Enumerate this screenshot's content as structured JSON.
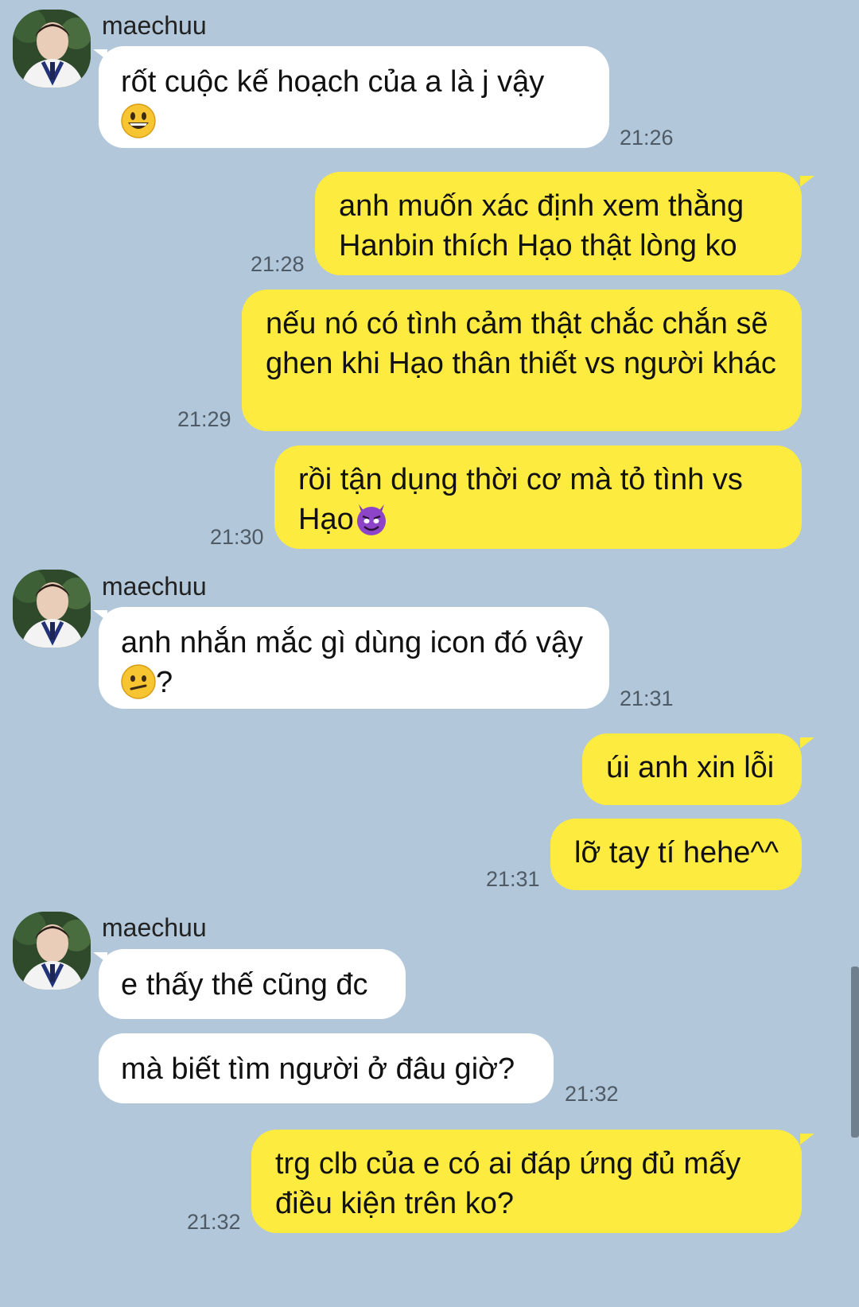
{
  "conversation": {
    "groups": [
      {
        "sender": "maechuu",
        "messages": [
          {
            "text": "rốt cuộc kế hoạch của a là j vậy",
            "emoji": "grinning-face-icon",
            "time": "21:26"
          }
        ]
      }
    ],
    "outgoing_1": [
      {
        "text": "anh muốn xác định xem thằng Hanbin thích Hạo thật lòng ko",
        "time": "21:28"
      },
      {
        "text": "nếu nó có tình cảm thật chắc chắn sẽ ghen khi Hạo thân thiết vs người khác",
        "time": "21:29"
      },
      {
        "text": "rồi tận dụng thời cơ mà tỏ tình vs Hạo",
        "emoji": "smiling-devil-icon",
        "time": "21:30"
      }
    ],
    "incoming_2": {
      "sender": "maechuu",
      "text_before": "anh nhắn mắc gì dùng icon đó vậy",
      "text_after": "?",
      "emoji": "confused-face-icon",
      "time": "21:31"
    },
    "outgoing_2": [
      {
        "text": "úi anh xin lỗi"
      },
      {
        "text": "lỡ tay tí hehe^^",
        "time": "21:31"
      }
    ],
    "incoming_3": {
      "sender": "maechuu",
      "messages": [
        {
          "text": "e thấy thế cũng đc"
        },
        {
          "text": "mà biết tìm người ở đâu giờ?",
          "time": "21:32"
        }
      ]
    },
    "outgoing_3": [
      {
        "text": "trg clb của e có ai đáp ứng đủ mấy điều kiện trên ko?",
        "time": "21:32"
      }
    ]
  },
  "colors": {
    "background": "#b2c7d9",
    "incoming_bubble": "#ffffff",
    "outgoing_bubble": "#fdeb3f",
    "timestamp": "#4e5a65"
  }
}
